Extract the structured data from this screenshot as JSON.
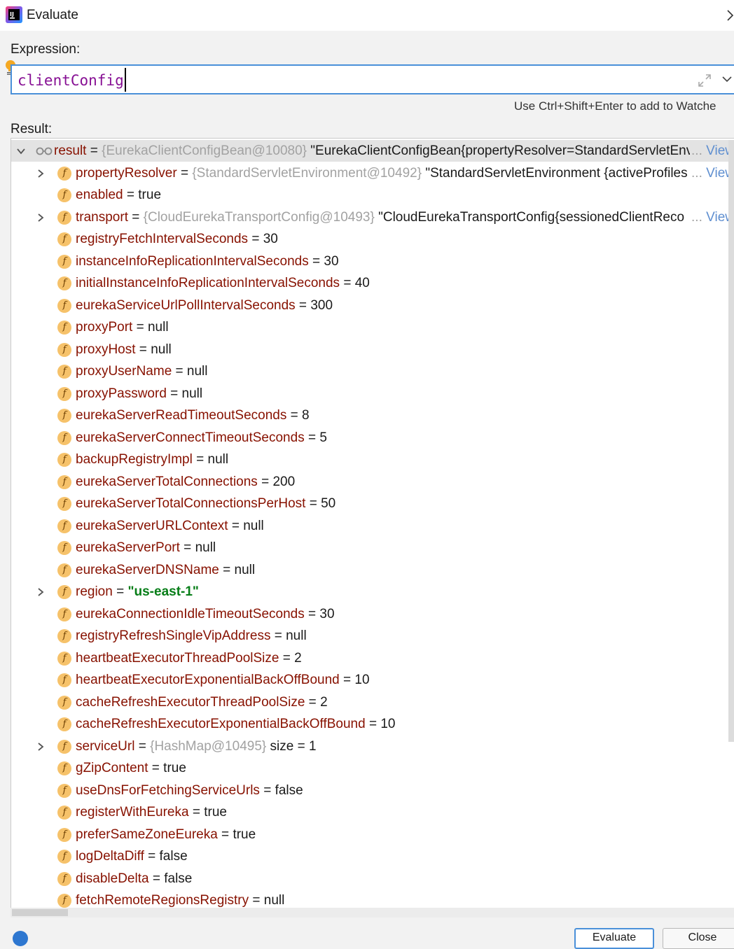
{
  "window": {
    "title": "Evaluate"
  },
  "expression": {
    "label": "Expression:",
    "value": "clientConfig",
    "hint": "Use Ctrl+Shift+Enter to add to Watche"
  },
  "result": {
    "label": "Result:",
    "root": {
      "name": "result",
      "ref": "{EurekaClientConfigBean@10080}",
      "str": "\"EurekaClientConfigBean{propertyResolver=StandardServletEnv",
      "link": "View"
    },
    "rows": [
      {
        "name": "propertyResolver",
        "ref": "{StandardServletEnvironment@10492}",
        "val": "\"StandardServletEnvironment {activeProfiles",
        "link": "View",
        "expandable": true
      },
      {
        "name": "enabled",
        "val": "true"
      },
      {
        "name": "transport",
        "ref": "{CloudEurekaTransportConfig@10493}",
        "val": "\"CloudEurekaTransportConfig{sessionedClientReco",
        "link": "View",
        "expandable": true
      },
      {
        "name": "registryFetchIntervalSeconds",
        "val": "30"
      },
      {
        "name": "instanceInfoReplicationIntervalSeconds",
        "val": "30"
      },
      {
        "name": "initialInstanceInfoReplicationIntervalSeconds",
        "val": "40"
      },
      {
        "name": "eurekaServiceUrlPollIntervalSeconds",
        "val": "300"
      },
      {
        "name": "proxyPort",
        "val": "null"
      },
      {
        "name": "proxyHost",
        "val": "null"
      },
      {
        "name": "proxyUserName",
        "val": "null"
      },
      {
        "name": "proxyPassword",
        "val": "null"
      },
      {
        "name": "eurekaServerReadTimeoutSeconds",
        "val": "8"
      },
      {
        "name": "eurekaServerConnectTimeoutSeconds",
        "val": "5"
      },
      {
        "name": "backupRegistryImpl",
        "val": "null"
      },
      {
        "name": "eurekaServerTotalConnections",
        "val": "200"
      },
      {
        "name": "eurekaServerTotalConnectionsPerHost",
        "val": "50"
      },
      {
        "name": "eurekaServerURLContext",
        "val": "null"
      },
      {
        "name": "eurekaServerPort",
        "val": "null"
      },
      {
        "name": "eurekaServerDNSName",
        "val": "null"
      },
      {
        "name": "region",
        "val": "us-east-1",
        "string": true,
        "expandable": true
      },
      {
        "name": "eurekaConnectionIdleTimeoutSeconds",
        "val": "30"
      },
      {
        "name": "registryRefreshSingleVipAddress",
        "val": "null"
      },
      {
        "name": "heartbeatExecutorThreadPoolSize",
        "val": "2"
      },
      {
        "name": "heartbeatExecutorExponentialBackOffBound",
        "val": "10"
      },
      {
        "name": "cacheRefreshExecutorThreadPoolSize",
        "val": "2"
      },
      {
        "name": "cacheRefreshExecutorExponentialBackOffBound",
        "val": "10"
      },
      {
        "name": "serviceUrl",
        "ref": "{HashMap@10495}",
        "val": "size = 1",
        "expandable": true
      },
      {
        "name": "gZipContent",
        "val": "true"
      },
      {
        "name": "useDnsForFetchingServiceUrls",
        "val": "false"
      },
      {
        "name": "registerWithEureka",
        "val": "true"
      },
      {
        "name": "preferSameZoneEureka",
        "val": "true"
      },
      {
        "name": "logDeltaDiff",
        "val": "false"
      },
      {
        "name": "disableDelta",
        "val": "false"
      },
      {
        "name": "fetchRemoteRegionsRegistry",
        "val": "null"
      }
    ]
  },
  "buttons": {
    "evaluate": "Evaluate",
    "close": "Close"
  },
  "icons": {
    "app": "intellij-logo-icon",
    "close": "chevron-right-icon",
    "bulb": "lightbulb-icon",
    "expand": "expand-icon",
    "dropdown": "chevron-down-icon",
    "watch": "watch-glasses-icon",
    "field": "field-f-icon"
  },
  "colors": {
    "field_name": "#871100",
    "reference": "#a2a2a2",
    "string_value": "#067d17",
    "link": "#5f8fd0",
    "expression_text": "#871094",
    "selection_border": "#4a90d9"
  }
}
